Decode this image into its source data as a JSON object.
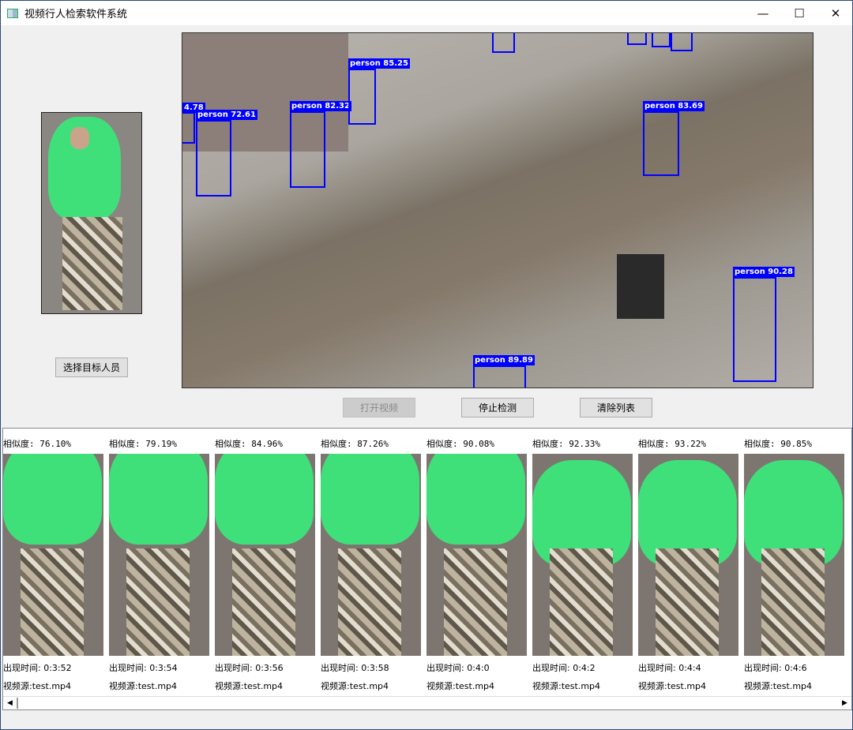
{
  "window": {
    "title": "视频行人检索软件系统",
    "minimize": "—",
    "maximize": "☐",
    "close": "✕"
  },
  "buttons": {
    "select_target": "选择目标人员",
    "open_video": "打开视频",
    "stop_detect": "停止检测",
    "clear_list": "清除列表"
  },
  "detections": [
    {
      "label": "4.78"
    },
    {
      "label": "person 72.61"
    },
    {
      "label": "person 82.32"
    },
    {
      "label": "person 85.25"
    },
    {
      "label": "person 83.69"
    },
    {
      "label": "person 90.28"
    },
    {
      "label": "person 89.89"
    }
  ],
  "results": [
    {
      "similarity": "相似度: 76.10%",
      "time": "出现时间: 0:3:52",
      "source": "视频源:test.mp4"
    },
    {
      "similarity": "相似度: 79.19%",
      "time": "出现时间: 0:3:54",
      "source": "视频源:test.mp4"
    },
    {
      "similarity": "相似度: 84.96%",
      "time": "出现时间: 0:3:56",
      "source": "视频源:test.mp4"
    },
    {
      "similarity": "相似度: 87.26%",
      "time": "出现时间: 0:3:58",
      "source": "视频源:test.mp4"
    },
    {
      "similarity": "相似度: 90.08%",
      "time": "出现时间: 0:4:0",
      "source": "视频源:test.mp4"
    },
    {
      "similarity": "相似度: 92.33%",
      "time": "出现时间: 0:4:2",
      "source": "视频源:test.mp4"
    },
    {
      "similarity": "相似度: 93.22%",
      "time": "出现时间: 0:4:4",
      "source": "视频源:test.mp4"
    },
    {
      "similarity": "相似度: 90.85%",
      "time": "出现时间: 0:4:6",
      "source": "视频源:test.mp4"
    }
  ],
  "scroll": {
    "left": "◀",
    "right": "▶"
  },
  "colors": {
    "box": "#0000ff",
    "hoodie": "#3fe07a"
  }
}
